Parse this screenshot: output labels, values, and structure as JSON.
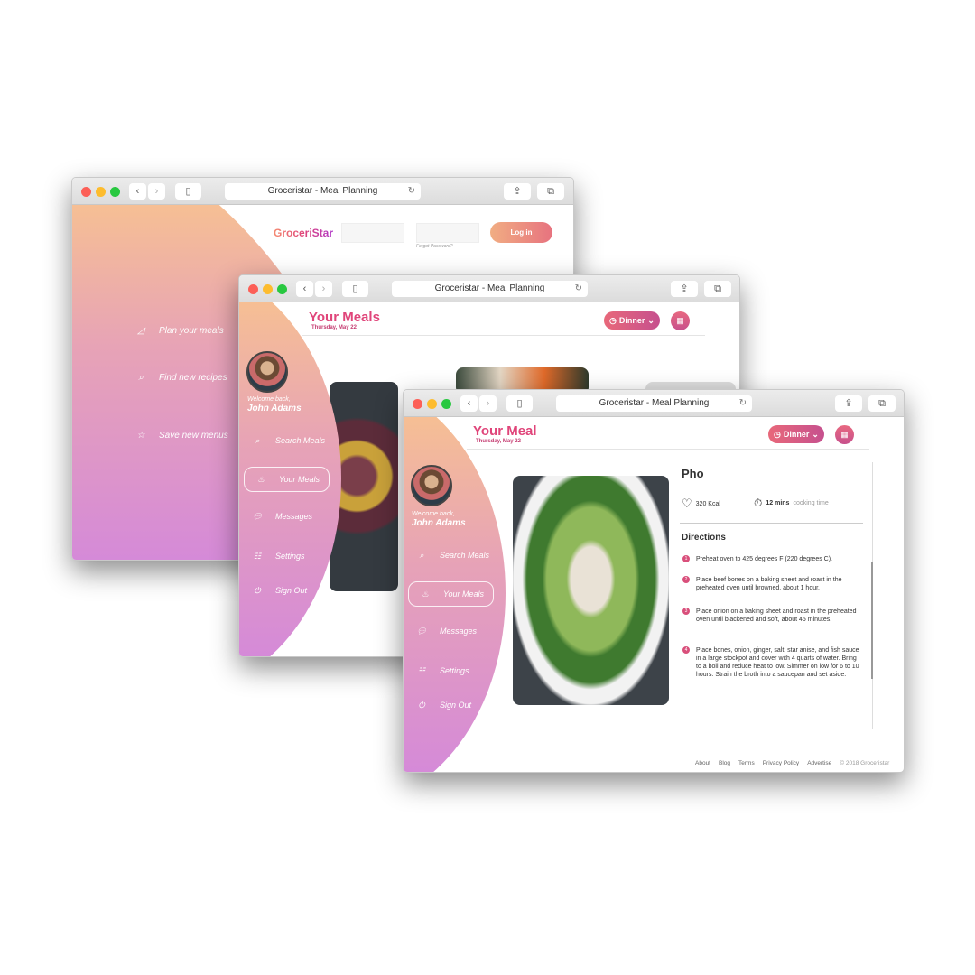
{
  "browser": {
    "title": "Groceristar - Meal Planning"
  },
  "login_window": {
    "logo": "GroceriStar",
    "username_value": "",
    "password_value": "",
    "forgot_password": "Forgot Password?",
    "login_button": "Log in",
    "features": [
      {
        "icon": "pizza-icon",
        "label": "Plan your meals"
      },
      {
        "icon": "search-icon",
        "label": "Find new recipes"
      },
      {
        "icon": "star-badge-icon",
        "label": "Save new menus"
      }
    ]
  },
  "sidebar": {
    "welcome": "Welcome back,",
    "user_name": "John Adams",
    "items": [
      {
        "icon": "search-icon",
        "label": "Search Meals"
      },
      {
        "icon": "cupcake-icon",
        "label": "Your Meals",
        "active": true
      },
      {
        "icon": "chat-bubble-icon",
        "label": "Messages"
      },
      {
        "icon": "sliders-icon",
        "label": "Settings"
      },
      {
        "icon": "power-icon",
        "label": "Sign Out"
      }
    ]
  },
  "meals_window": {
    "title": "Your Meals",
    "date": "Thursday, May 22",
    "meal_selector": "Dinner"
  },
  "meal_window": {
    "title": "Your Meal",
    "date": "Thursday, May 22",
    "meal_selector": "Dinner",
    "recipe": {
      "name": "Pho",
      "calories": "320 Kcal",
      "time": "12 mins",
      "time_label": "cooking time",
      "directions_heading": "Directions",
      "steps": [
        {
          "n": "1",
          "text": "Preheat oven to 425 degrees F (220 degrees C)."
        },
        {
          "n": "2",
          "text": "Place beef bones on a baking sheet and roast in the preheated oven until browned, about 1 hour."
        },
        {
          "n": "3",
          "text": "Place onion on a baking sheet and roast in the preheated oven until blackened and soft, about 45 minutes."
        },
        {
          "n": "4",
          "text": "Place bones, onion, ginger, salt, star anise, and fish sauce in a large stockpot and cover with 4 quarts of water. Bring to a boil and reduce heat to low. Simmer on low for 6 to 10 hours. Strain the broth into a saucepan and set aside."
        }
      ]
    },
    "footer": [
      "About",
      "Blog",
      "Terms",
      "Privacy Policy",
      "Advertise",
      "© 2018 Groceristar"
    ]
  },
  "colors": {
    "accent": "#e0457a",
    "gradient_top": "#f6bf94",
    "gradient_bottom": "#d58ad8"
  }
}
